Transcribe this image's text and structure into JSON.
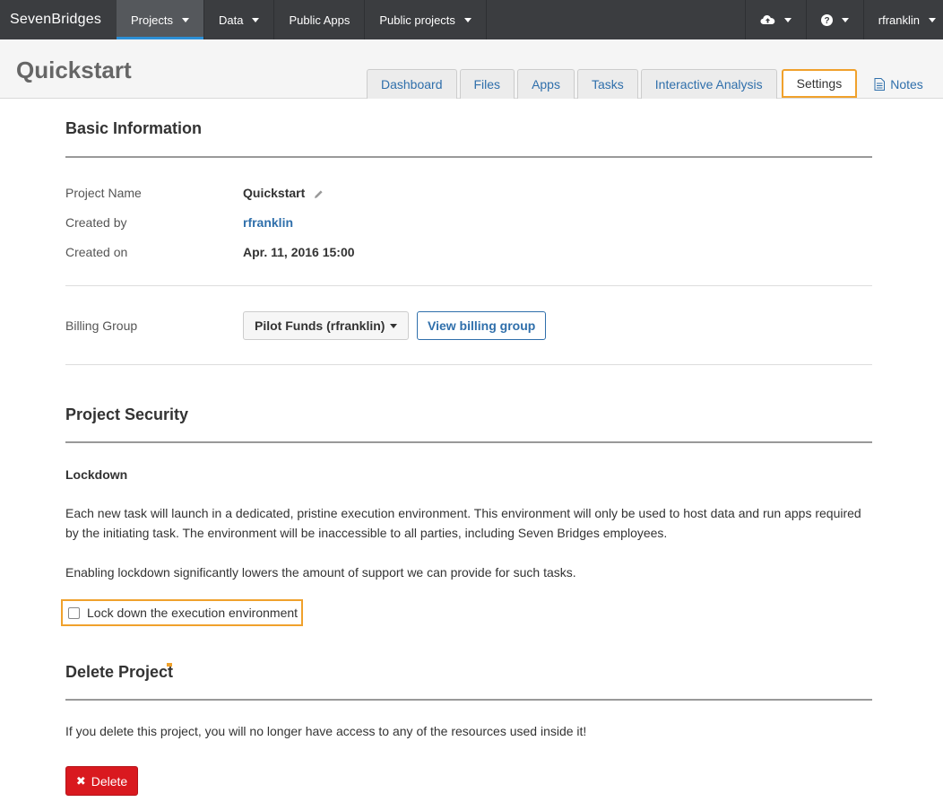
{
  "navbar": {
    "brand": "SevenBridges",
    "items": [
      {
        "label": "Projects",
        "has_caret": true,
        "active": true
      },
      {
        "label": "Data",
        "has_caret": true,
        "active": false
      },
      {
        "label": "Public Apps",
        "has_caret": false,
        "active": false
      },
      {
        "label": "Public projects",
        "has_caret": true,
        "active": false
      }
    ],
    "upload_icon": "cloud-upload-icon",
    "help_icon": "question-circle-icon",
    "user": "rfranklin"
  },
  "header": {
    "title": "Quickstart",
    "tabs": [
      "Dashboard",
      "Files",
      "Apps",
      "Tasks",
      "Interactive Analysis",
      "Settings"
    ],
    "selected_tab": "Settings",
    "notes_label": "Notes"
  },
  "basic_info": {
    "title": "Basic Information",
    "project_name_label": "Project Name",
    "project_name": "Quickstart",
    "created_by_label": "Created by",
    "created_by": "rfranklin",
    "created_on_label": "Created on",
    "created_on": "Apr. 11, 2016 15:00",
    "billing_group_label": "Billing Group",
    "billing_group": "Pilot Funds (rfranklin)",
    "view_billing_label": "View billing group"
  },
  "security": {
    "title": "Project Security",
    "lockdown_title": "Lockdown",
    "para1": "Each new task will launch in a dedicated, pristine execution environment. This environment will only be used to host data and run apps required by the initiating task. The environment will be inaccessible to all parties, including Seven Bridges employees.",
    "para2": "Enabling lockdown significantly lowers the amount of support we can provide for such tasks.",
    "checkbox_label": "Lock down the execution environment",
    "checked": false
  },
  "delete": {
    "title": "Delete Project",
    "warning": "If you delete this project, you will no longer have access to any of the resources used inside it!",
    "button_label": "Delete"
  },
  "colors": {
    "navbar_bg": "#3b3d40",
    "accent_blue": "#2f6fab",
    "highlight_orange": "#f0a12c",
    "danger_red": "#d9191f"
  }
}
